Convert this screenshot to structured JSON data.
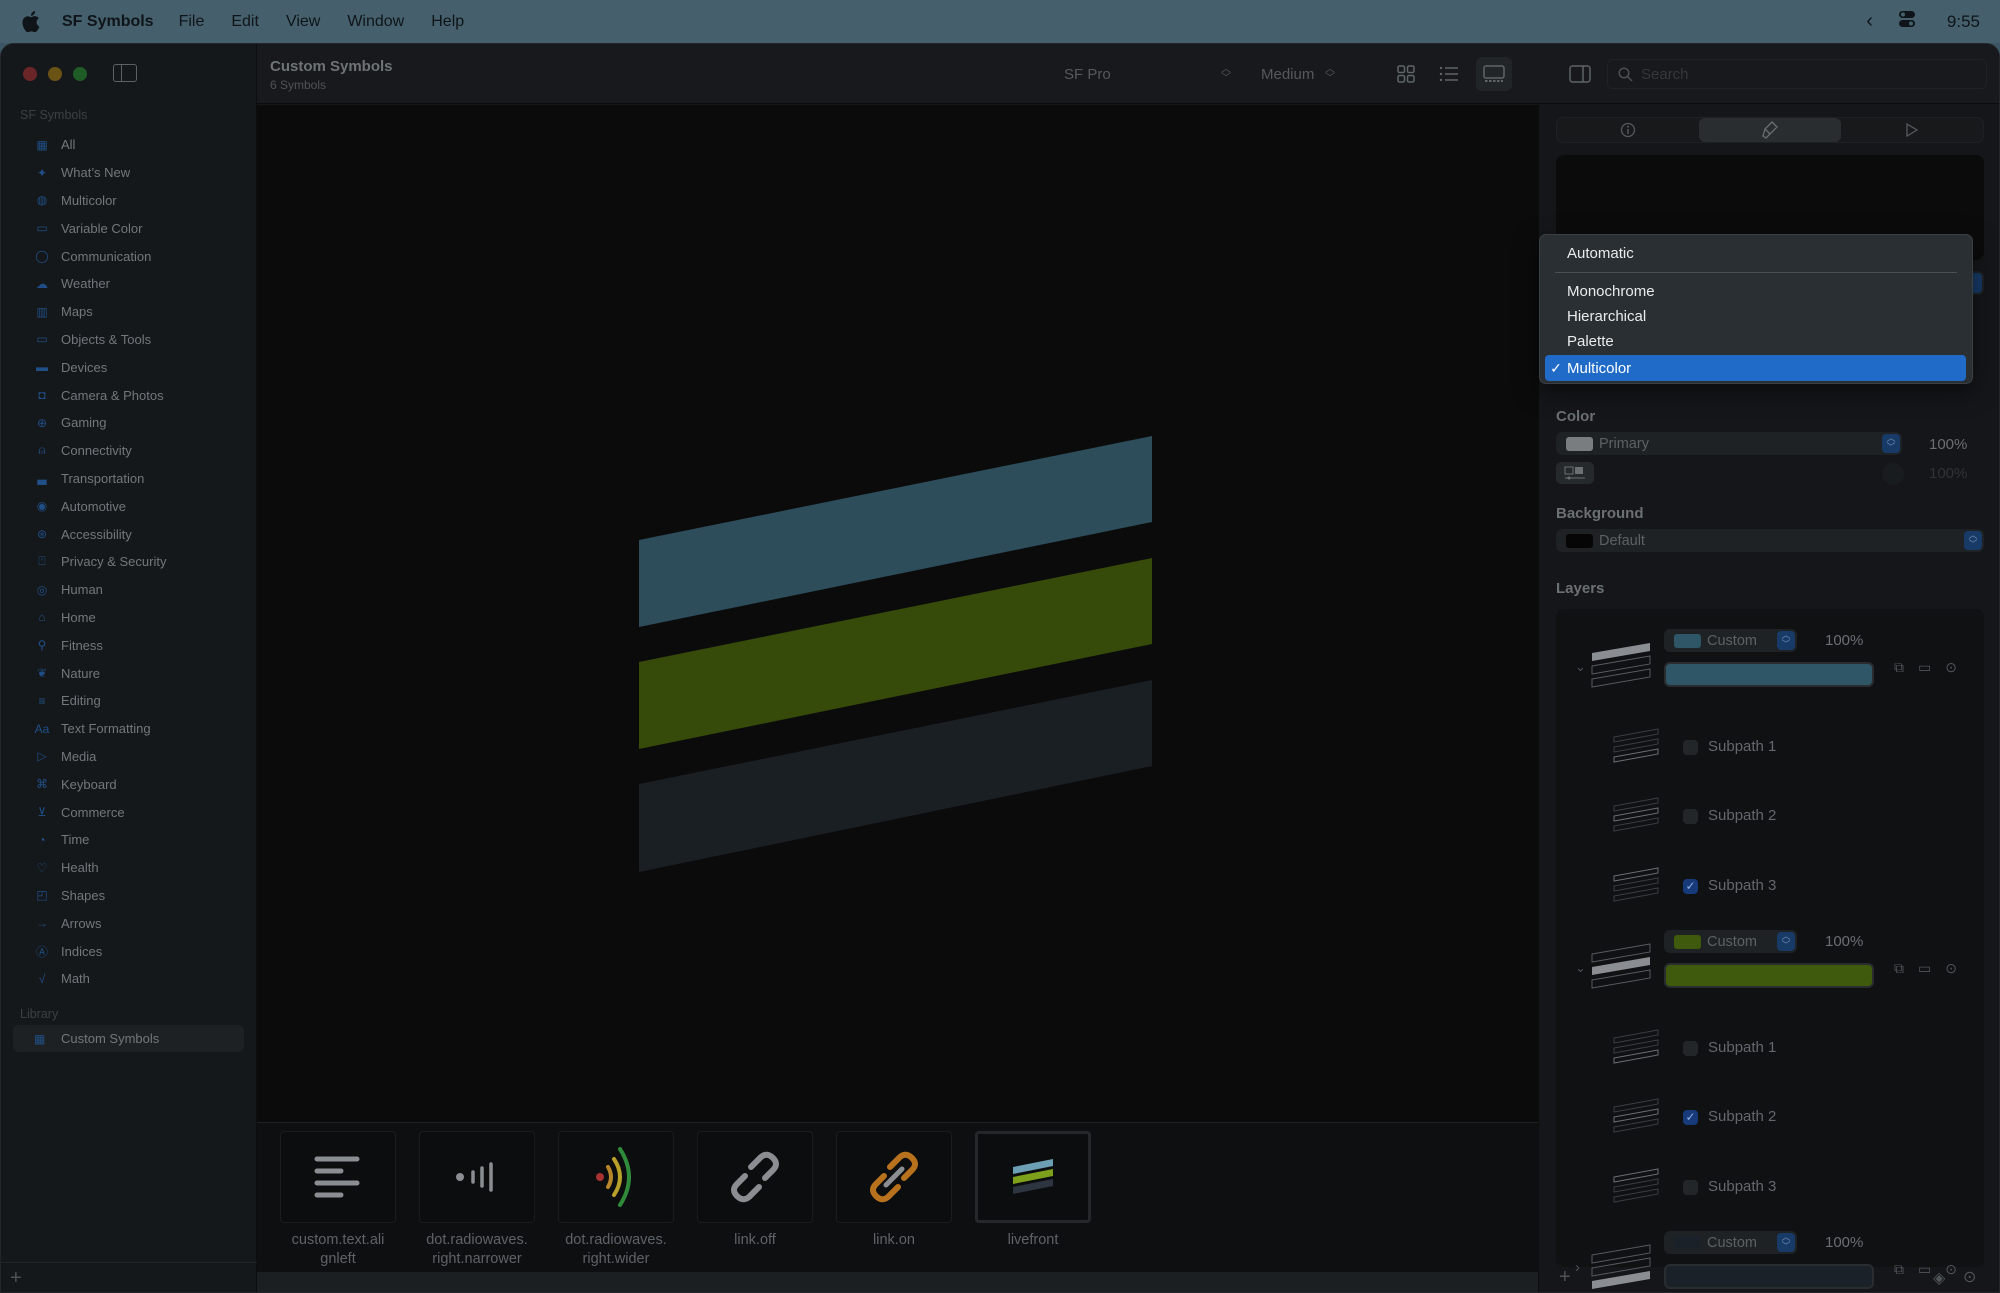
{
  "menubar": {
    "app_name": "SF Symbols",
    "items": [
      "File",
      "Edit",
      "View",
      "Window",
      "Help"
    ],
    "clock": "9:55"
  },
  "sidebar": {
    "section_title": "SF Symbols",
    "items": [
      {
        "label": "All",
        "icon": "grid-icon",
        "glyph": "▦"
      },
      {
        "label": "What’s New",
        "icon": "sparkles-icon",
        "glyph": "✦"
      },
      {
        "label": "Multicolor",
        "icon": "paintpalette-icon",
        "glyph": "◍"
      },
      {
        "label": "Variable Color",
        "icon": "variable-color-icon",
        "glyph": "▭"
      },
      {
        "label": "Communication",
        "icon": "message-icon",
        "glyph": "◯"
      },
      {
        "label": "Weather",
        "icon": "cloud-sun-icon",
        "glyph": "☁"
      },
      {
        "label": "Maps",
        "icon": "map-icon",
        "glyph": "▥"
      },
      {
        "label": "Objects & Tools",
        "icon": "folder-icon",
        "glyph": "▭"
      },
      {
        "label": "Devices",
        "icon": "display-icon",
        "glyph": "▬"
      },
      {
        "label": "Camera & Photos",
        "icon": "camera-icon",
        "glyph": "◘"
      },
      {
        "label": "Gaming",
        "icon": "gamecontroller-icon",
        "glyph": "⊕"
      },
      {
        "label": "Connectivity",
        "icon": "antenna-icon",
        "glyph": "⍝"
      },
      {
        "label": "Transportation",
        "icon": "car-icon",
        "glyph": "▃"
      },
      {
        "label": "Automotive",
        "icon": "steeringwheel-icon",
        "glyph": "◉"
      },
      {
        "label": "Accessibility",
        "icon": "accessibility-icon",
        "glyph": "⊛"
      },
      {
        "label": "Privacy & Security",
        "icon": "lock-icon",
        "glyph": "⍞"
      },
      {
        "label": "Human",
        "icon": "person-circle-icon",
        "glyph": "◎"
      },
      {
        "label": "Home",
        "icon": "house-icon",
        "glyph": "⌂"
      },
      {
        "label": "Fitness",
        "icon": "figure-run-icon",
        "glyph": "⚲"
      },
      {
        "label": "Nature",
        "icon": "leaf-icon",
        "glyph": "❦"
      },
      {
        "label": "Editing",
        "icon": "sliders-icon",
        "glyph": "≡"
      },
      {
        "label": "Text Formatting",
        "icon": "textformat-icon",
        "glyph": "Aa"
      },
      {
        "label": "Media",
        "icon": "playpause-icon",
        "glyph": "▷"
      },
      {
        "label": "Keyboard",
        "icon": "command-icon",
        "glyph": "⌘"
      },
      {
        "label": "Commerce",
        "icon": "cart-icon",
        "glyph": "⊻"
      },
      {
        "label": "Time",
        "icon": "timer-icon",
        "glyph": "◔"
      },
      {
        "label": "Health",
        "icon": "heart-icon",
        "glyph": "♡"
      },
      {
        "label": "Shapes",
        "icon": "shapes-icon",
        "glyph": "◰"
      },
      {
        "label": "Arrows",
        "icon": "arrow-right-icon",
        "glyph": "→"
      },
      {
        "label": "Indices",
        "icon": "a-circle-icon",
        "glyph": "Ⓐ"
      },
      {
        "label": "Math",
        "icon": "sqrt-icon",
        "glyph": "√"
      }
    ],
    "library_title": "Library",
    "library_item": {
      "label": "Custom Symbols",
      "icon": "grid-icon",
      "glyph": "▦"
    }
  },
  "toolbar": {
    "title": "Custom Symbols",
    "subtitle": "6 Symbols",
    "font_select": "SF Pro",
    "weight_select": "Medium",
    "search_placeholder": "Search"
  },
  "canvas": {
    "symbol_name": "livefront",
    "layer_colors": [
      "#2d4d5b",
      "#364a0a",
      "#1a1f24"
    ]
  },
  "gallery": {
    "tiles": [
      {
        "label": "custom.text.alignleft",
        "line1": "custom.text.ali",
        "line2": "gnleft"
      },
      {
        "label": "dot.radiowaves.right.narrower",
        "line1": "dot.radiowaves.",
        "line2": "right.narrower"
      },
      {
        "label": "dot.radiowaves.right.wider",
        "line1": "dot.radiowaves.",
        "line2": "right.wider"
      },
      {
        "label": "link.off",
        "line1": "link.off",
        "line2": ""
      },
      {
        "label": "link.on",
        "line1": "link.on",
        "line2": ""
      },
      {
        "label": "livefront",
        "line1": "livefront",
        "line2": ""
      }
    ],
    "selected": "livefront"
  },
  "inspector": {
    "tabs": [
      "info",
      "customize",
      "play"
    ],
    "active_tab": "customize",
    "rendering_mode_menu": {
      "options": [
        "Automatic",
        "Monochrome",
        "Hierarchical",
        "Palette",
        "Multicolor"
      ],
      "selected": "Multicolor"
    },
    "color_label": "Color",
    "color_value": "Primary",
    "color_opacity": "100%",
    "variable_opacity": "100%",
    "background_label": "Background",
    "background_value": "Default",
    "layers_label": "Layers",
    "layers": [
      {
        "color_mode": "Custom",
        "opacity": "100%",
        "color": "#2f5666",
        "expanded": true,
        "subpaths": [
          {
            "label": "Subpath 1",
            "checked": false
          },
          {
            "label": "Subpath 2",
            "checked": false
          },
          {
            "label": "Subpath 3",
            "checked": true
          }
        ]
      },
      {
        "color_mode": "Custom",
        "opacity": "100%",
        "color": "#3f5a0c",
        "expanded": true,
        "subpaths": [
          {
            "label": "Subpath 1",
            "checked": false
          },
          {
            "label": "Subpath 2",
            "checked": true
          },
          {
            "label": "Subpath 3",
            "checked": false
          }
        ]
      },
      {
        "color_mode": "Custom",
        "opacity": "100%",
        "color": "#1b2128",
        "expanded": false,
        "subpaths": []
      }
    ]
  }
}
